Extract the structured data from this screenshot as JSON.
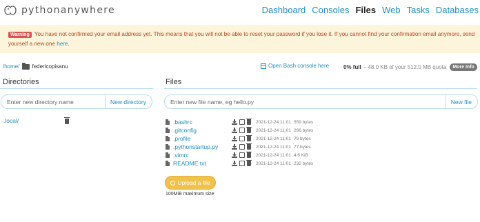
{
  "header": {
    "logo_text": "pythonanywhere",
    "nav": [
      {
        "label": "Dashboard",
        "active": false
      },
      {
        "label": "Consoles",
        "active": false
      },
      {
        "label": "Files",
        "active": true
      },
      {
        "label": "Web",
        "active": false
      },
      {
        "label": "Tasks",
        "active": false
      },
      {
        "label": "Databases",
        "active": false
      }
    ]
  },
  "warning": {
    "badge": "Warning",
    "text": "You have not confirmed your email address yet. This means that you will not be able to reset your password if you lose it. If you cannot find your confirmation email anymore, send yourself a new one",
    "link": "here",
    "end": "."
  },
  "path": {
    "home_link": "/home/",
    "user": "federicopisanu"
  },
  "bash_link": "Open Bash console here",
  "quota": {
    "percent": "0% full",
    "detail": "– 48.0 KB of your 512.0 MB quota",
    "more_info": "More Info"
  },
  "directories": {
    "title": "Directories",
    "placeholder": "Enter new directory name",
    "button": "New directory",
    "items": [
      ".local/"
    ]
  },
  "files": {
    "title": "Files",
    "placeholder": "Enter new file name, eg hello.py",
    "button": "New file",
    "items": [
      {
        "name": ".bashrc",
        "date": "2021-12-24 11:01",
        "size": "559 bytes"
      },
      {
        "name": ".gitconfig",
        "date": "2021-12-24 11:01",
        "size": "266 bytes"
      },
      {
        "name": ".profile",
        "date": "2021-12-24 11:01",
        "size": "79 bytes"
      },
      {
        "name": ".pythonstartup.py",
        "date": "2021-12-24 11:01",
        "size": "77 bytes"
      },
      {
        "name": ".vimrc",
        "date": "2021-12-24 11:01",
        "size": "4.6 KiB"
      },
      {
        "name": "README.txt",
        "date": "2021-12-24 11:01",
        "size": "232 bytes"
      }
    ],
    "upload_label": "Upload a file",
    "upload_note": "100MiB maximum size"
  }
}
